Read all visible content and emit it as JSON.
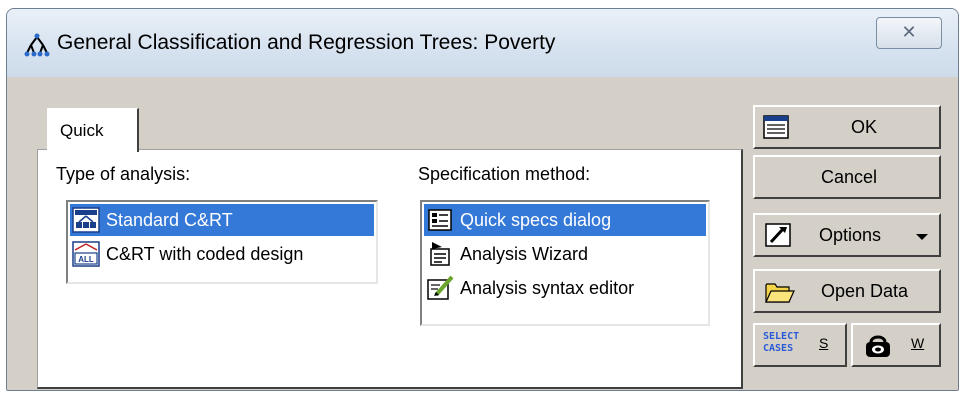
{
  "window": {
    "title": "General Classification and Regression Trees: Poverty",
    "close_glyph": "✕"
  },
  "tabs": [
    {
      "label": "Quick"
    }
  ],
  "type_of_analysis": {
    "label": "Type of analysis:",
    "items": [
      {
        "label": "Standard C&RT",
        "selected": true
      },
      {
        "label": "C&RT with coded design",
        "selected": false
      }
    ]
  },
  "specification_method": {
    "label": "Specification method:",
    "items": [
      {
        "label": "Quick specs dialog",
        "selected": true
      },
      {
        "label": "Analysis Wizard",
        "selected": false
      },
      {
        "label": "Analysis syntax editor",
        "selected": false
      }
    ]
  },
  "buttons": {
    "ok": "OK",
    "cancel": "Cancel",
    "options": "Options",
    "open_data": "Open Data",
    "select_cases_icon": "SELECT CASES",
    "s": "S",
    "w": "W"
  },
  "colors": {
    "selection": "#3478d8",
    "dialog": "#d4d0c8",
    "titlebar": "#dbe6f1"
  }
}
